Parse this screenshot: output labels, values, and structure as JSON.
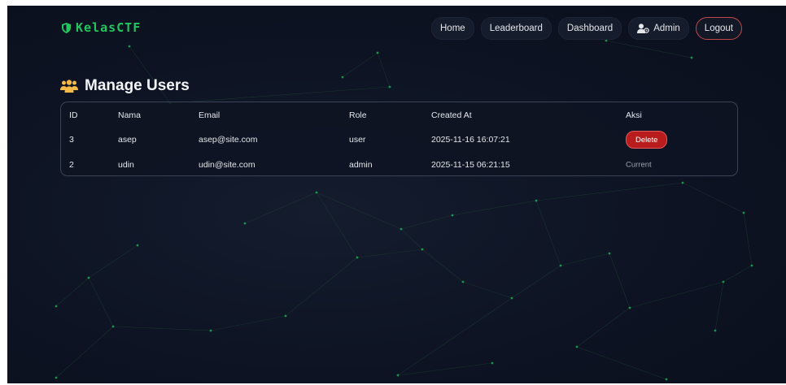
{
  "brand": {
    "name": "KelasCTF",
    "icon": "shield-icon",
    "color": "#22c55e"
  },
  "nav": {
    "home": "Home",
    "leaderboard": "Leaderboard",
    "dashboard": "Dashboard",
    "admin": "Admin",
    "logout": "Logout"
  },
  "page": {
    "title": "Manage Users",
    "title_icon": "users-icon"
  },
  "table": {
    "headers": [
      "ID",
      "Nama",
      "Email",
      "Role",
      "Created At",
      "Aksi"
    ],
    "rows": [
      {
        "id": "3",
        "nama": "asep",
        "email": "asep@site.com",
        "role": "user",
        "created_at": "2025-11-16 16:07:21",
        "aksi": "Delete"
      },
      {
        "id": "2",
        "nama": "udin",
        "email": "udin@site.com",
        "role": "admin",
        "created_at": "2025-11-15 06:21:15",
        "aksi": "Current"
      }
    ]
  },
  "colors": {
    "accent": "#22c55e",
    "danger": "#b91c1c",
    "background": "#0d1322"
  }
}
